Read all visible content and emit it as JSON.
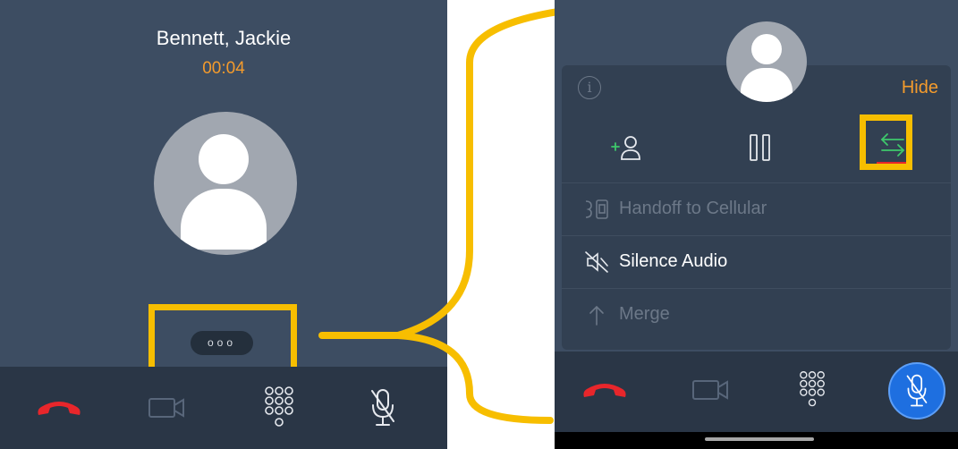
{
  "left_call": {
    "contact_name": "Bennett, Jackie",
    "call_timer": "00:04",
    "more_button_label": "ooo",
    "controls": {
      "end_call_icon": "phone-hangup-icon",
      "video_icon": "video-camera-icon",
      "keypad_icon": "dialpad-icon",
      "mute_icon": "mic-muted-icon"
    }
  },
  "right_call": {
    "info_icon_glyph": "i",
    "hide_label": "Hide",
    "actions": {
      "add_participant_icon": "add-person-icon",
      "hold_icon": "pause-icon",
      "transfer_icon": "swap-arrows-icon"
    },
    "menu": [
      {
        "label": "Handoff to Cellular",
        "icon": "handoff-cellular-icon",
        "enabled": false
      },
      {
        "label": "Silence Audio",
        "icon": "speaker-muted-icon",
        "enabled": true
      },
      {
        "label": "Merge",
        "icon": "merge-arrow-icon",
        "enabled": false
      }
    ]
  },
  "colors": {
    "panel_bg": "#3d4d62",
    "card_bg": "#324052",
    "bar_bg": "#2a3646",
    "accent_orange": "#f49b2c",
    "highlight_yellow": "#f7be00",
    "end_call_red": "#e8262b",
    "mute_active_blue": "#1e6fe0",
    "swap_green": "#3ec86b"
  }
}
